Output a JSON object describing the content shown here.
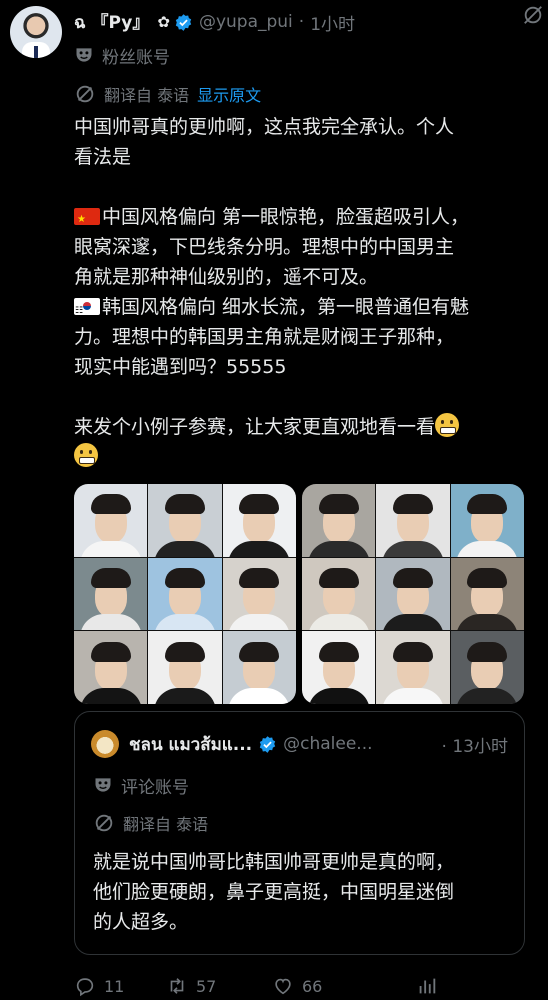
{
  "post": {
    "author_name": "ฉ 『Py』",
    "author_badge_glyph": "✿",
    "handle": "@yupa_pui",
    "time_sep": "·",
    "time": "1小时",
    "fan_account_label": "粉丝账号",
    "translated_from": "翻译自 泰语",
    "show_original": "显示原文",
    "text_lines": [
      "中国帅哥真的更帅啊，这点我完全承认。个人",
      "看法是",
      "",
      "中国风格偏向 第一眼惊艳，脸蛋超吸引人，",
      "眼窝深邃，下巴线条分明。理想中的中国男主",
      "角就是那种神仙级别的，遥不可及。",
      "韩国风格偏向 细水长流，第一眼普通但有魅",
      "力。理想中的韩国男主角就是财阀王子那种，",
      "现实中能遇到吗？55555",
      "",
      "来发个小例子参赛，让大家更直观地看一看"
    ],
    "icons": {
      "grok": "grok-icon",
      "verified": "verified-badge-icon",
      "mask": "theater-mask-icon",
      "translate": "translate-icon",
      "flag_cn": "china-flag-icon",
      "flag_kr": "south-korea-flag-icon",
      "emoji": "grimacing-face-emoji"
    }
  },
  "colors": {
    "background": "#000000",
    "text": "#e7e9ea",
    "muted": "#71767b",
    "link": "#1d9bf0",
    "verified": "#1d9bf0",
    "border": "#2f3336"
  },
  "media": {
    "left_grid_tiles": 9,
    "right_grid_tiles": 9
  },
  "quote": {
    "author_name": "ชลน แมวส้มแ...",
    "handle": "@chalee...",
    "time_sep": "·",
    "time": "13小时",
    "account_label": "评论账号",
    "translated_from": "翻译自 泰语",
    "text_lines": [
      "就是说中国帅哥比韩国帅哥更帅是真的啊，",
      "他们脸更硬朗，鼻子更高挺，中国明星迷倒",
      "的人超多。"
    ]
  },
  "actions": {
    "replies": "11",
    "reposts": "57",
    "likes": "66"
  }
}
